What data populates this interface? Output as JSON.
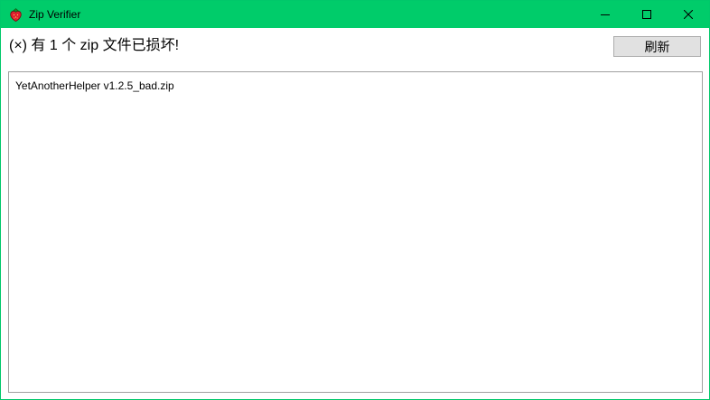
{
  "window": {
    "title": "Zip Verifier",
    "icon": "strawberry-icon",
    "controls": [
      "minimize-icon",
      "maximize-icon",
      "close-icon"
    ],
    "accent_color": "#00cc6a"
  },
  "toolbar": {
    "status_message": "(×) 有 1 个 zip 文件已损坏!",
    "refresh_label": "刷新"
  },
  "file_list": {
    "items": [
      {
        "name": "YetAnotherHelper v1.2.5_bad.zip"
      }
    ]
  }
}
